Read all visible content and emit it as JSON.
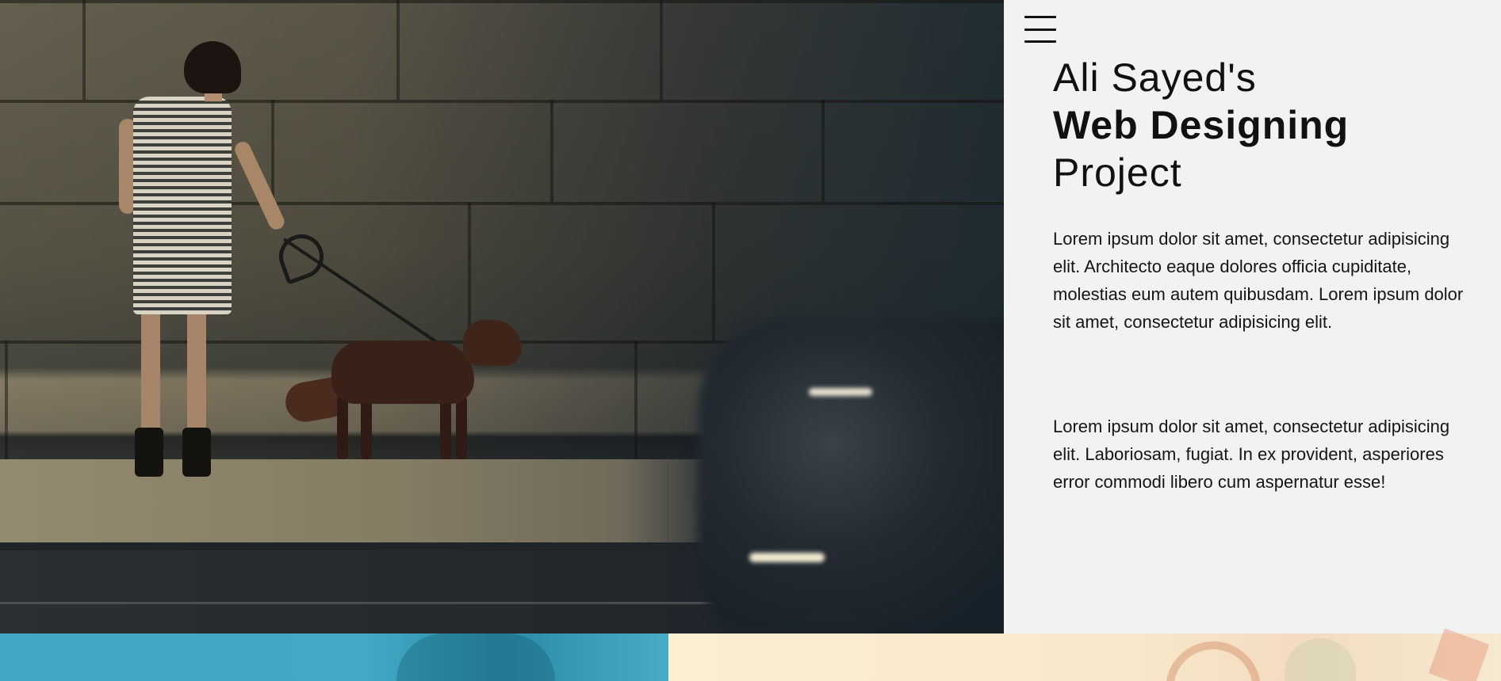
{
  "header": {
    "menu_icon": "hamburger-menu-icon"
  },
  "hero": {
    "image_description_icon": "photo-woman-walking-dog"
  },
  "content": {
    "title": {
      "line1": "Ali Sayed's",
      "line2": "Web Designing",
      "line3": "Project"
    },
    "paragraphs": [
      "Lorem ipsum dolor sit amet, consectetur adipisicing elit. Architecto eaque dolores officia cupiditate, molestias eum autem quibusdam. Lorem ipsum dolor sit amet, consectetur adipisicing elit.",
      "Lorem ipsum dolor sit amet, consectetur adipisicing elit. Laboriosam, fugiat. In ex provident, asperiores error commodi libero cum aspernatur esse!"
    ]
  },
  "colors": {
    "panel_background": "#f2f2f2",
    "text": "#111111",
    "bottom_left_accent": "#41a9c4",
    "bottom_right_accent": "#fbeed3"
  }
}
